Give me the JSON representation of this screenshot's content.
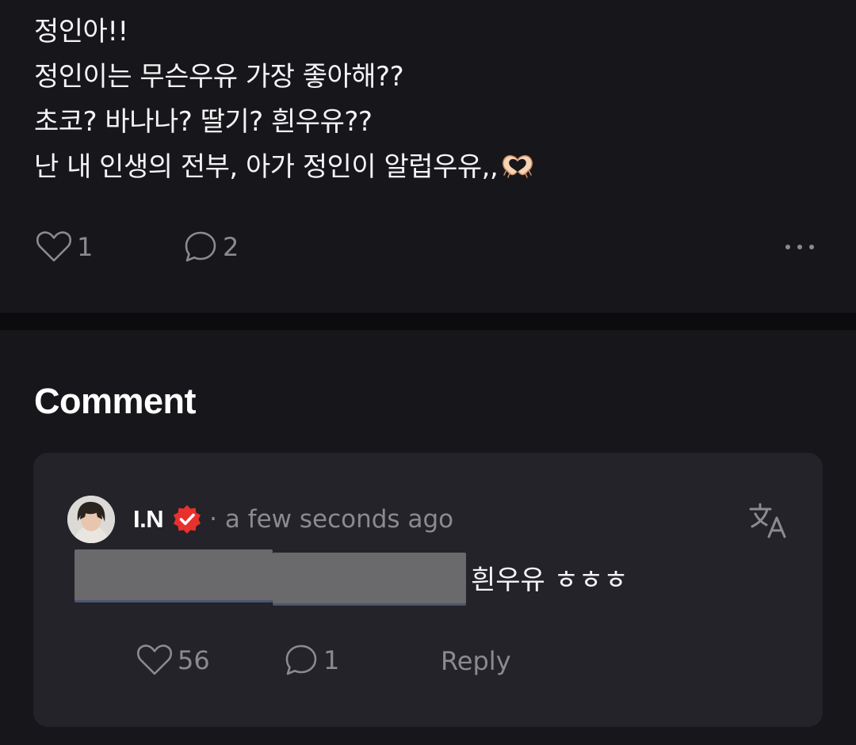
{
  "post": {
    "lines": [
      "정인아!!",
      "정인이는 무슨우유 가장 좋아해??",
      "초코? 바나나? 딸기? 흰우유??",
      "난 내 인생의 전부, 아가 정인이 알럽우유,,"
    ],
    "emoji_icon": "heart-hands-icon",
    "like_count": "1",
    "comment_count": "2"
  },
  "comments": {
    "title": "Comment",
    "items": [
      {
        "author": "I.N",
        "verified": true,
        "time": "· a few seconds ago",
        "text": "흰우유 ㅎㅎㅎ",
        "like_count": "56",
        "comment_count": "1",
        "reply_label": "Reply"
      }
    ]
  },
  "colors": {
    "background": "#17171b",
    "card": "#232329",
    "muted": "#8a8a90",
    "verified_badge": "#e8312d",
    "divider": "#0c0c0e"
  }
}
